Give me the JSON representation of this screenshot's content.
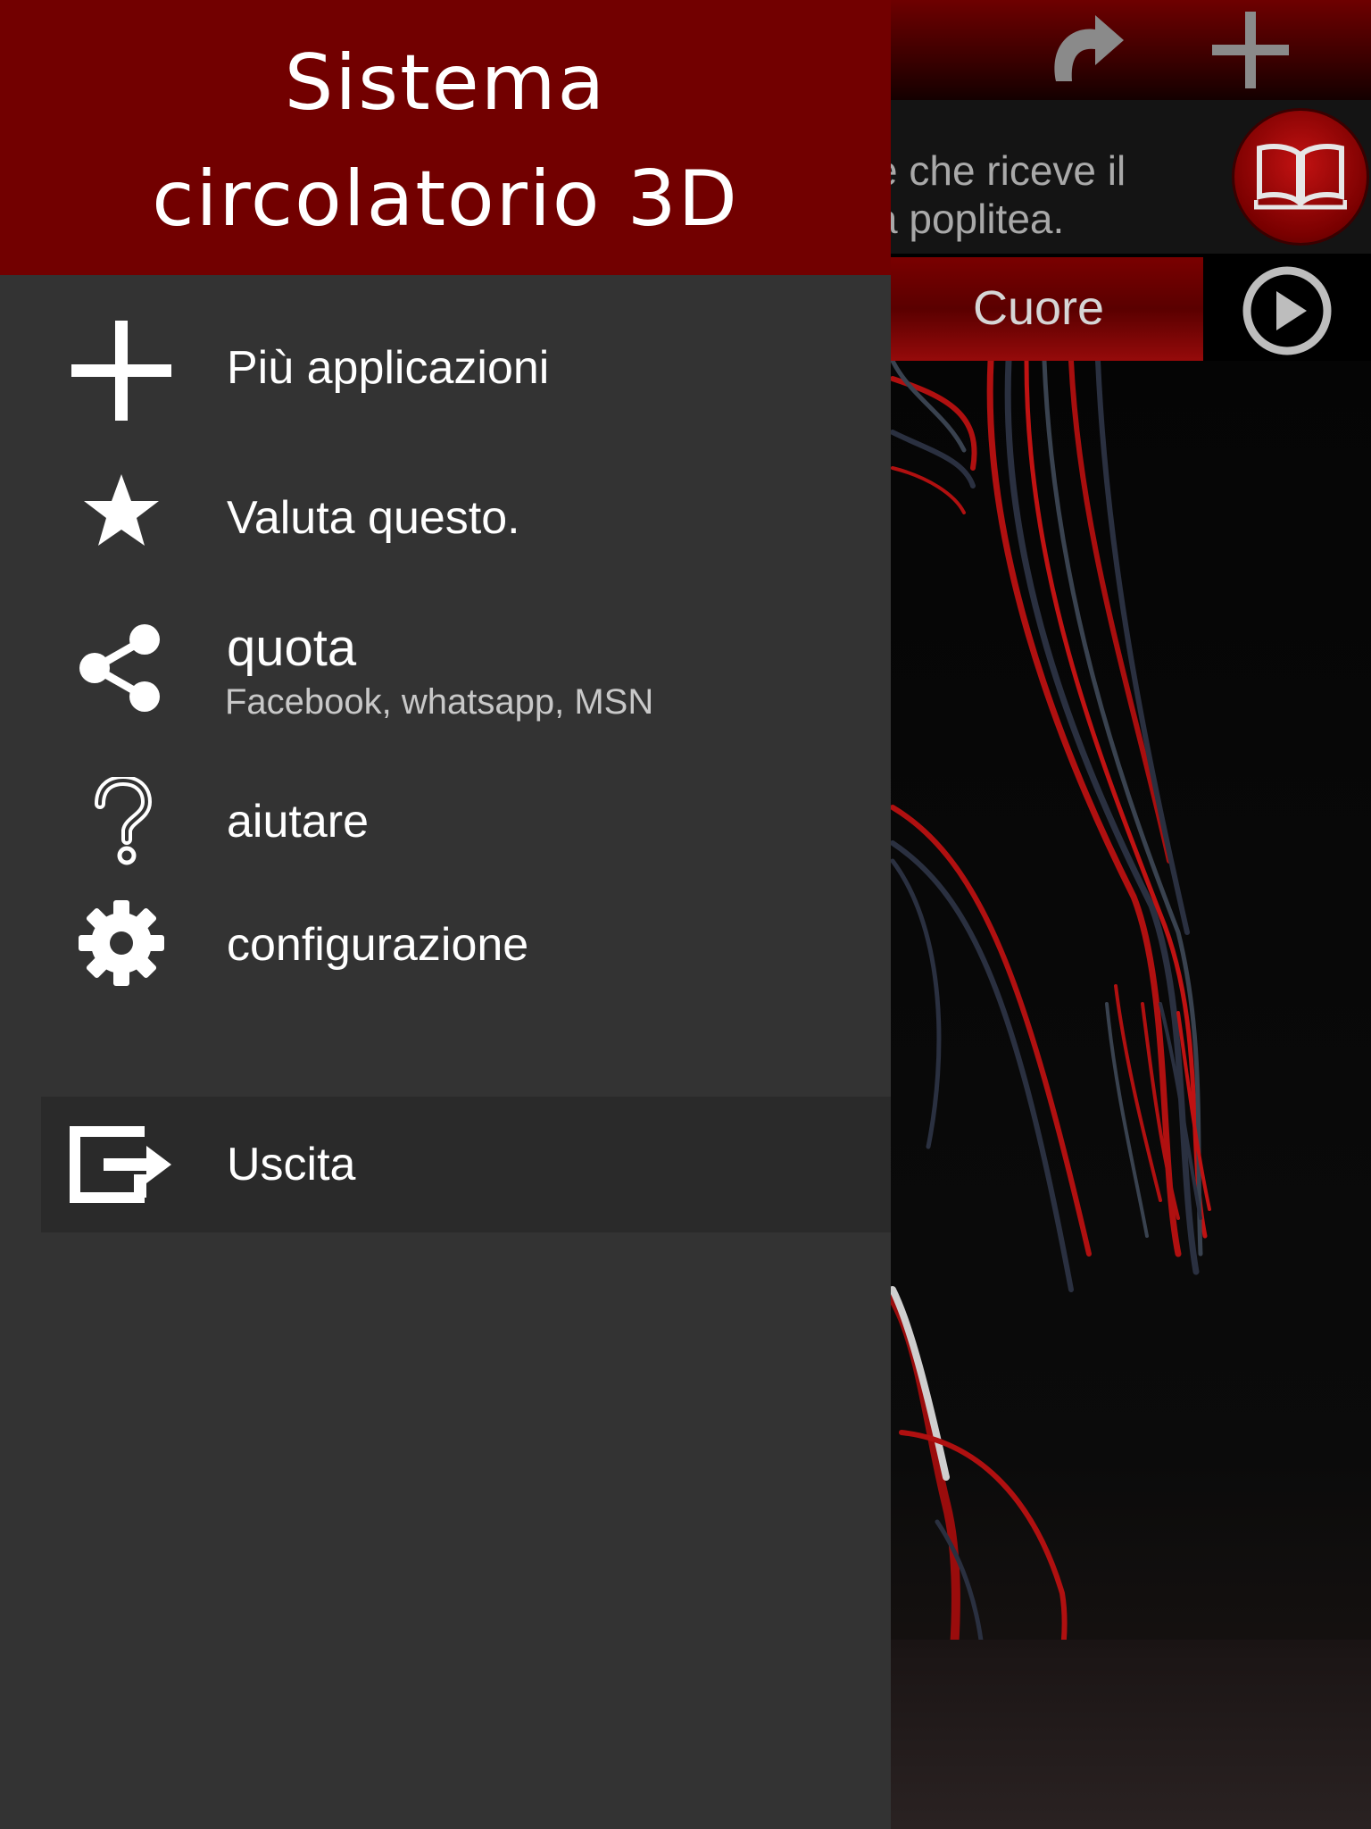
{
  "app": {
    "title": "Sistema\ncircolatorio 3D",
    "info_text_line1": "e che riceve il",
    "info_text_line2": "a poplitea.",
    "organ_tab_label": "Cuore",
    "accent_color": "#720000",
    "drawer_bg": "#333333"
  },
  "toolbar": {
    "redo_icon": "redo-icon",
    "add_icon": "plus-icon",
    "book_icon": "book-icon",
    "play_icon": "play-icon"
  },
  "drawer": {
    "items": [
      {
        "label": "Più applicazioni",
        "icon": "plus-icon"
      },
      {
        "label": "Valuta questo.",
        "icon": "star-icon"
      },
      {
        "label": "quota",
        "sublabel": "Facebook, whatsapp, MSN",
        "icon": "share-icon"
      },
      {
        "label": "aiutare",
        "icon": "question-icon"
      },
      {
        "label": "configurazione",
        "icon": "gear-icon"
      }
    ],
    "exit": {
      "label": "Uscita",
      "icon": "exit-icon"
    }
  }
}
